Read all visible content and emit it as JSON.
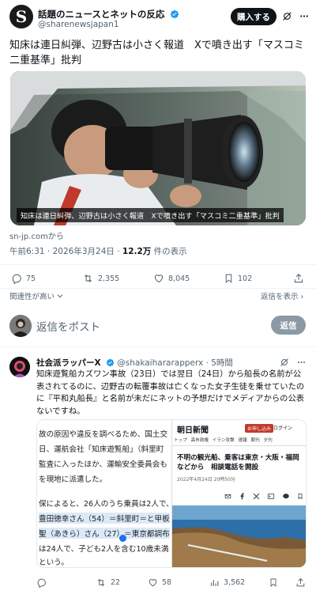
{
  "tweet": {
    "author_initial": "S",
    "author_name": "話題のニュースとネットの反応",
    "author_handle": "@sharenewsjapan1",
    "subscribe_label": "購入する",
    "text": "知床は連日糾弾、辺野古は小さく報道　Xで噴き出す「マスコミ二重基準」批判",
    "image_caption": "知床は連日糾弾、辺野古は小さく報道　Xで噴き出す「マスコミ二重基準」批判",
    "link_source": "sn-jp.comから",
    "time": "午前6:31",
    "date": "2026年3月24日",
    "views_count": "12.2万",
    "views_label": "件の表示",
    "replies": "75",
    "reposts": "2,355",
    "likes": "8,045",
    "bookmarks": "102"
  },
  "sort": {
    "label": "関連性が高い",
    "show_all": "返信を表示 ›"
  },
  "reply_box": {
    "placeholder": "返信をポスト",
    "button": "返信"
  },
  "reply_tweet": {
    "author_name": "社会派ラッパーX",
    "author_handle": "@shakaihararapperx",
    "time": "5時間",
    "text": "知床遊覧船カズワン事故（23日）では翌日（24日）から船長の名前が公表されてるのに、辺野古の転覆事故は亡くなった女子生徒を乗せていたのに『平和丸船長』と名前が未だにネットの予想だけでメディアからの公表ないですね。",
    "doc_lines": [
      "故の原因や違反を調べるため、国土交",
      "日、運航会社「知床遊覧船」（斜里町",
      "監査に入ったほか、運輸安全委員会も",
      "を現地に派遣した。",
      "",
      "保によると、26人のうち乗員は2人で、",
      "豊田徳幸さん（54）＝斜里町＝と甲板",
      "聖（あきら）さん（27）＝東京都調布",
      "は24人で、子ども2人を含む10歳未満",
      "という。"
    ],
    "news": {
      "logo": "朝日新聞",
      "trial_button": "お申し込み",
      "login": "ログイン",
      "nav": [
        "トップ",
        "高市政権",
        "イラン攻撃",
        "速報",
        "朝刊",
        "夕刊"
      ],
      "headline": "不明の観光船、乗客は東京・大阪・福岡などから　相談電話を開設",
      "date": "2022年4月24日 20時50分"
    },
    "replies": "",
    "reposts": "22",
    "likes": "58",
    "views": "3,562"
  },
  "colors": {
    "text": "#0f1419",
    "muted": "#536471",
    "verified": "#1d9bf0",
    "reply_button": "#8b98a5"
  }
}
